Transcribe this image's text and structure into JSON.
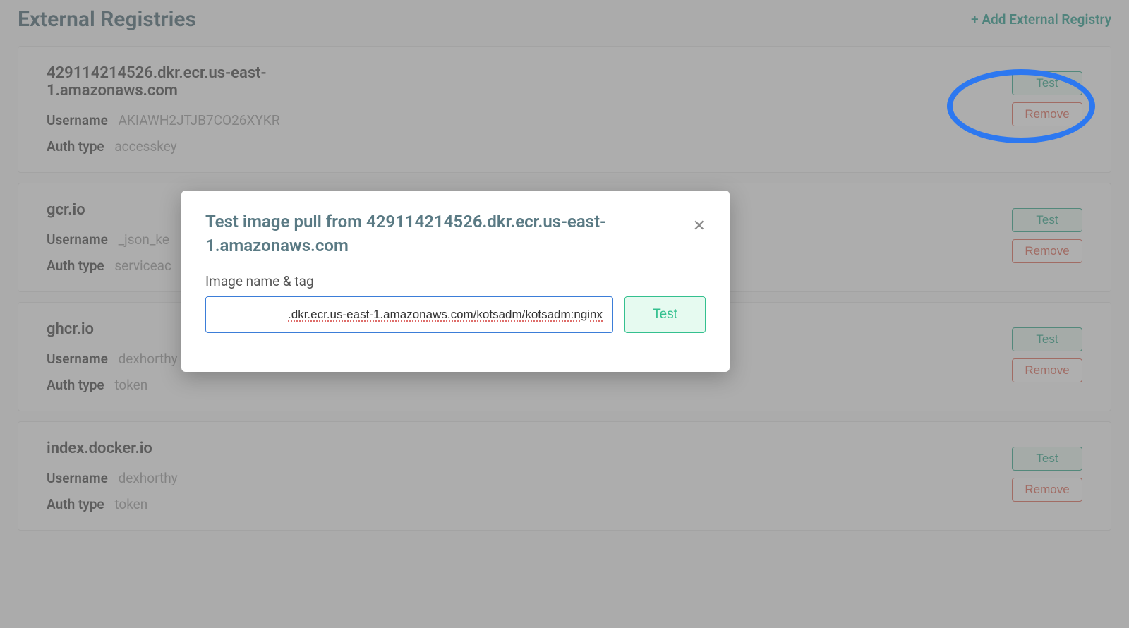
{
  "header": {
    "title": "External Registries",
    "add_link": "+ Add External Registry"
  },
  "labels": {
    "username": "Username",
    "authtype": "Auth type",
    "test": "Test",
    "remove": "Remove"
  },
  "registries": [
    {
      "host": "429114214526.dkr.ecr.us-east-1.amazonaws.com",
      "username": "AKIAWH2JTJB7CO26XYKR",
      "authtype": "accesskey"
    },
    {
      "host": "gcr.io",
      "username": "_json_ke",
      "authtype": "serviceac"
    },
    {
      "host": "ghcr.io",
      "username": "dexhorthy",
      "authtype": "token"
    },
    {
      "host": "index.docker.io",
      "username": "dexhorthy",
      "authtype": "token"
    }
  ],
  "modal": {
    "title": "Test image pull from 429114214526.dkr.ecr.us-east-1.amazonaws.com",
    "field_label": "Image name & tag",
    "input_value": ".dkr.ecr.us-east-1.amazonaws.com/kotsadm/kotsadm:nginx",
    "test_button": "Test",
    "close": "✕"
  }
}
